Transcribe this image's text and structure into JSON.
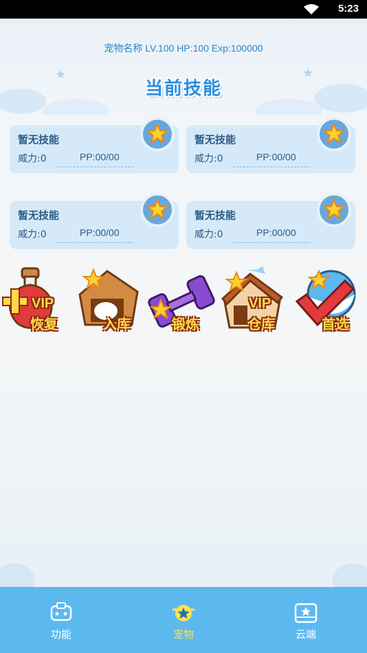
{
  "status_bar": {
    "time": "5:23",
    "icons": [
      "wifi-icon",
      "battery-icon"
    ]
  },
  "pet": {
    "info": "宠物名称 LV.100 HP:100 Exp:100000"
  },
  "skills_section": {
    "title": "当前技能"
  },
  "skills": [
    {
      "name": "暂无技能",
      "power": "威力:0",
      "pp": "PP:00/00",
      "icon": "star-icon"
    },
    {
      "name": "暂无技能",
      "power": "威力:0",
      "pp": "PP:00/00",
      "icon": "star-icon"
    },
    {
      "name": "暂无技能",
      "power": "威力:0",
      "pp": "PP:00/00",
      "icon": "star-icon"
    },
    {
      "name": "暂无技能",
      "power": "威力:0",
      "pp": "PP:00/00",
      "icon": "star-icon"
    }
  ],
  "actions": [
    {
      "label": "恢复",
      "badge": "VIP",
      "icon": "potion-icon"
    },
    {
      "label": "入库",
      "badge": "",
      "icon": "doghouse-icon"
    },
    {
      "label": "锻炼",
      "badge": "",
      "icon": "dumbbell-icon"
    },
    {
      "label": "仓库",
      "badge": "VIP",
      "icon": "house-icon"
    },
    {
      "label": "首选",
      "badge": "",
      "icon": "checkmark-ball-icon"
    }
  ],
  "bottom_nav": {
    "items": [
      {
        "label": "功能",
        "icon": "robot-icon",
        "active": false
      },
      {
        "label": "宠物",
        "icon": "star-badge-icon",
        "active": true
      },
      {
        "label": "云端",
        "icon": "cloud-card-icon",
        "active": false
      }
    ]
  },
  "colors": {
    "accent": "#5cb9f0",
    "active_label": "#ffe14a",
    "card_bg": "#d6e9f8",
    "text_blue": "#2a86c9"
  }
}
